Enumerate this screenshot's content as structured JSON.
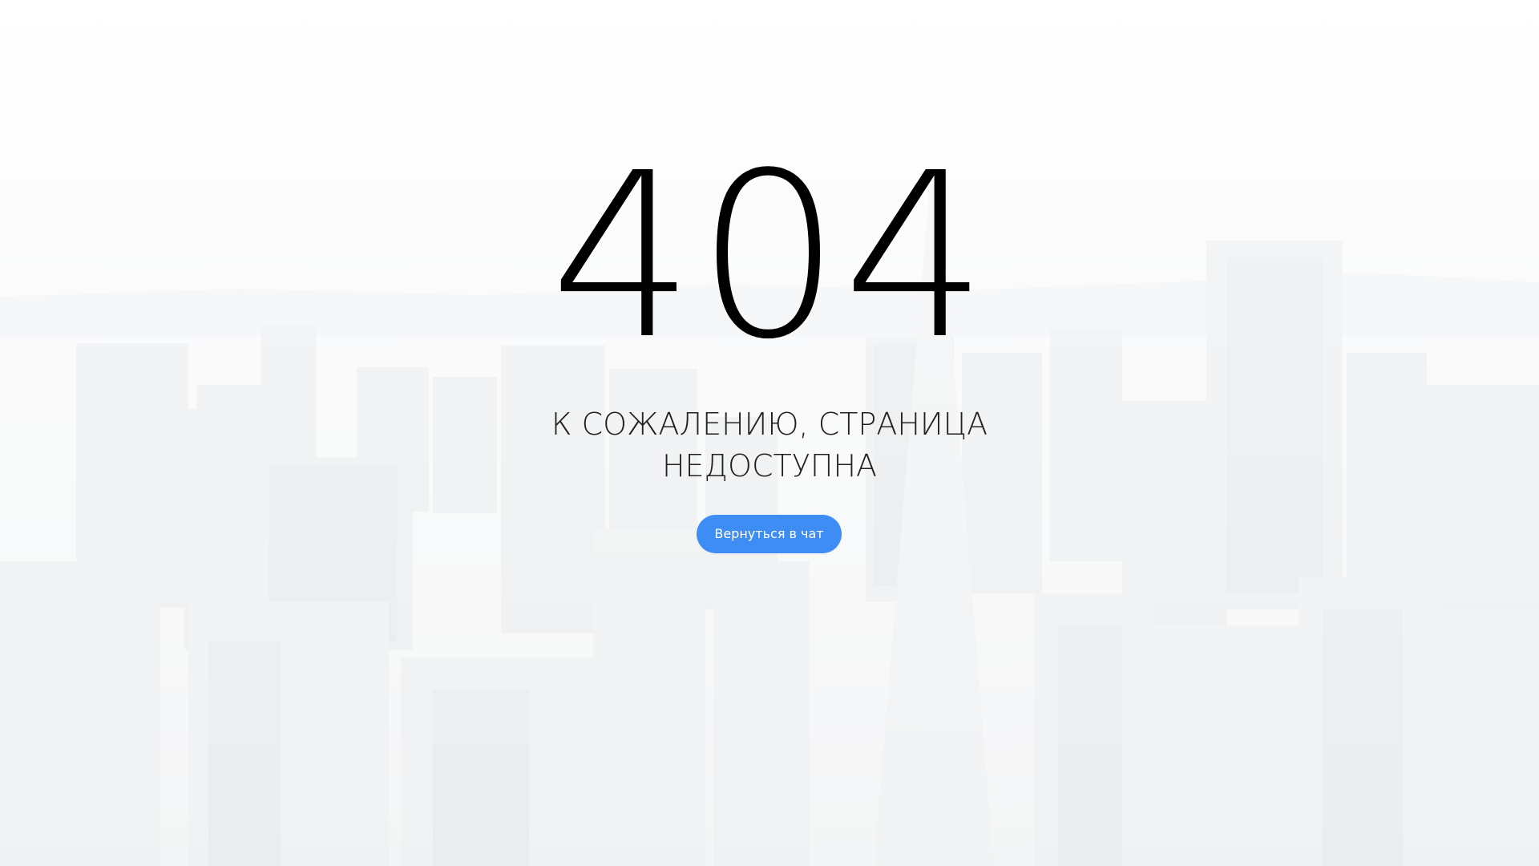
{
  "page": {
    "error_code": "404",
    "message_line1": "К СОЖАЛЕНИЮ, СТРАНИЦА",
    "message_line2": "НЕДОСТУПНА",
    "back_button_label": "Вернуться в чат"
  },
  "colors": {
    "accent": "#3d8df5",
    "text": "#000000",
    "background_tint": "#f7f8f9"
  }
}
